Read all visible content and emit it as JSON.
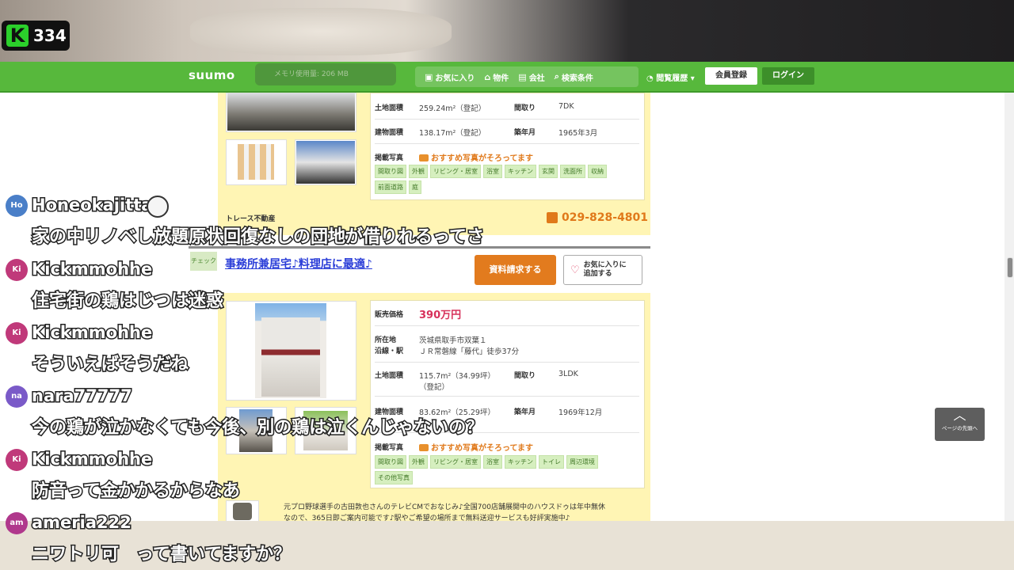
{
  "stream": {
    "viewer_count": "334",
    "logo_letter": "K"
  },
  "navbar": {
    "logo": "suumo",
    "memory": "メモリ使用量: 206 MB",
    "items": [
      {
        "label": "お気に入り",
        "icon": "heart-box-icon"
      },
      {
        "label": "物件",
        "icon": "house-icon"
      },
      {
        "label": "会社",
        "icon": "building-icon"
      },
      {
        "label": "検索条件",
        "icon": "search-icon"
      }
    ],
    "history": "閲覧履歴",
    "register": "会員登録",
    "login": "ログイン"
  },
  "listing1": {
    "land_area_label": "土地面積",
    "land_area": "259.24m²（登記）",
    "layout_label": "間取り",
    "layout": "7DK",
    "building_area_label": "建物面積",
    "building_area": "138.17m²（登記）",
    "built_label": "築年月",
    "built": "1965年3月",
    "photos_label": "掲載写真",
    "photos_note": "おすすめ写真がそろってます",
    "tags": [
      "間取り図",
      "外観",
      "リビング・居室",
      "浴室",
      "キッチン",
      "玄関",
      "洗面所",
      "収納",
      "前面道路",
      "庭"
    ],
    "company": "トレース不動産",
    "phone": "029-828-4801"
  },
  "listing2": {
    "check": "チェック",
    "title": "事務所兼居宅♪料理店に最適♪",
    "request_button": "資料請求する",
    "favorite_button_line1": "お気に入りに",
    "favorite_button_line2": "追加する",
    "price_label": "販売価格",
    "price": "390万円",
    "location_label": "所在地",
    "location": "茨城県取手市双葉１",
    "station_label": "沿線・駅",
    "station": "ＪＲ常磐線「藤代」徒歩37分",
    "land_area_label": "土地面積",
    "land_area": "115.7m²（34.99坪）",
    "land_area_note": "（登記）",
    "layout_label": "間取り",
    "layout": "3LDK",
    "building_area_label": "建物面積",
    "building_area": "83.62m²（25.29坪）",
    "built_label": "築年月",
    "built": "1969年12月",
    "photos_label": "掲載写真",
    "photos_note": "おすすめ写真がそろってます",
    "tags": [
      "間取り図",
      "外観",
      "リビング・居室",
      "浴室",
      "キッチン",
      "トイレ",
      "周辺環境",
      "その他写真"
    ],
    "promo_line1": "元プロ野球選手の古田敦也さんのテレビCMでおなじみ♪全国700店舗展開中のハウスドゥは年中無休",
    "promo_line2": "なので、365日即ご案内可能です♪駅やご希望の場所まで無料送迎サービスも好評実施中♪"
  },
  "back_to_top": "ページの先頭へ",
  "comments": [
    {
      "avatar": "Ho",
      "avatar_color": "#4a7fc8",
      "name": "Honeokajitta",
      "message": "家の中リノベし放題原状回復なしの団地が借りれるってさ"
    },
    {
      "avatar": "Ki",
      "avatar_color": "#c0397a",
      "name": "Kickmmohhe",
      "message": "住宅街の鶏はじつは迷惑"
    },
    {
      "avatar": "Ki",
      "avatar_color": "#c0397a",
      "name": "Kickmmohhe",
      "message": "そういえばそうだね"
    },
    {
      "avatar": "na",
      "avatar_color": "#7a5ac8",
      "name": "nara77777",
      "message": "今の鶏が泣かなくても今後、別の鶏は泣くんじゃないの？"
    },
    {
      "avatar": "Ki",
      "avatar_color": "#c0397a",
      "name": "Kickmmohhe",
      "message": "防音って金かかるからなあ"
    },
    {
      "avatar": "am",
      "avatar_color": "#b0388c",
      "name": "ameria222",
      "message": "ニワトリ可　って書いてますか？"
    }
  ]
}
